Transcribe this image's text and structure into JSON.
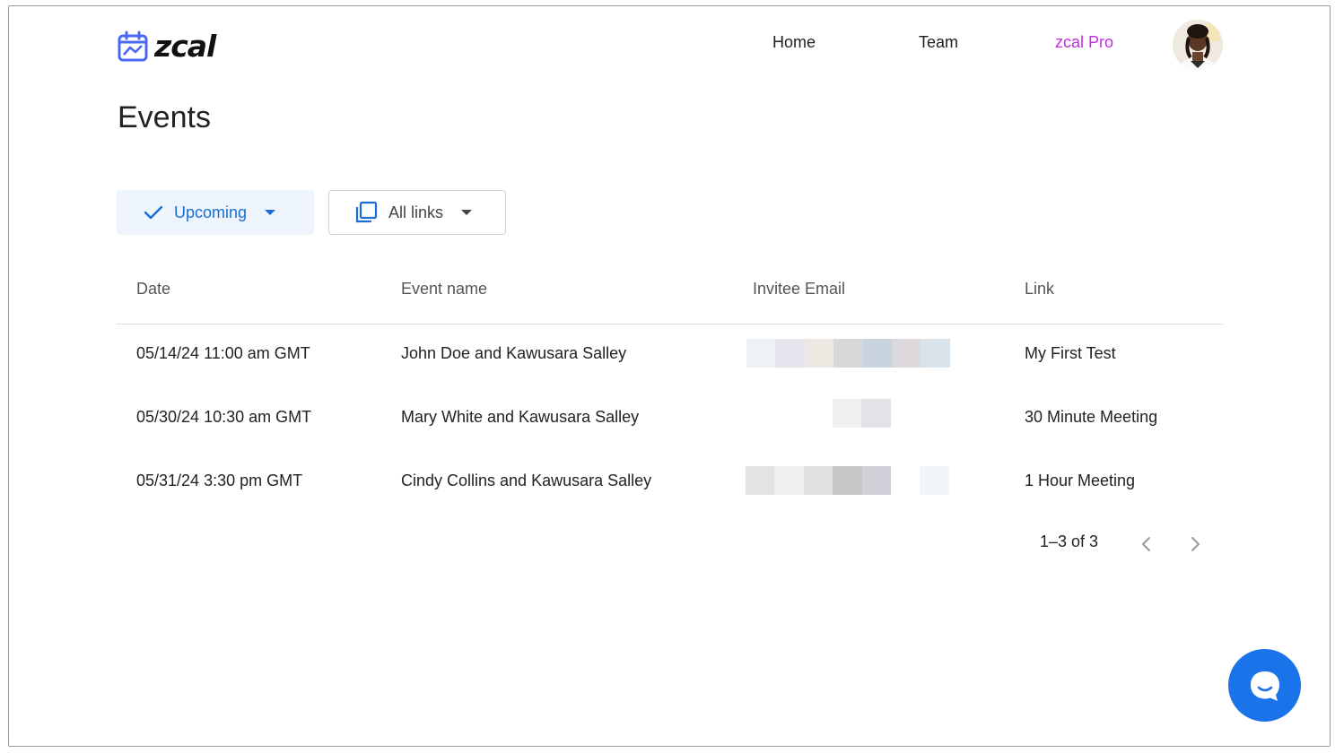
{
  "brand": {
    "name": "zcal",
    "accent": "#4a67f5"
  },
  "nav": {
    "home": "Home",
    "team": "Team",
    "pro": "zcal Pro",
    "pro_color": "#c02ee0"
  },
  "page": {
    "title": "Events"
  },
  "filters": {
    "upcoming": {
      "label": "Upcoming",
      "color": "#1a6fd6"
    },
    "links": {
      "label": "All links",
      "color": "#444444"
    }
  },
  "table": {
    "headers": {
      "date": "Date",
      "event_name": "Event name",
      "invitee_email": "Invitee Email",
      "link": "Link"
    },
    "rows": [
      {
        "date": "05/14/24 11:00 am GMT",
        "event_name": "John Doe and Kawusara Salley",
        "link": "My First Test"
      },
      {
        "date": "05/30/24 10:30 am GMT",
        "event_name": "Mary White and Kawusara Salley",
        "link": "30 Minute Meeting"
      },
      {
        "date": "05/31/24 3:30 pm GMT",
        "event_name": "Cindy Collins and Kawusara Salley",
        "link": "1 Hour Meeting"
      }
    ]
  },
  "pagination": {
    "label": "1–3 of 3"
  },
  "icons": {
    "logo": "calendar-icon",
    "upcoming": "check-icon",
    "links": "copy-icon",
    "prev": "chevron-left-icon",
    "next": "chevron-right-icon",
    "chat": "chat-bubble-icon"
  }
}
